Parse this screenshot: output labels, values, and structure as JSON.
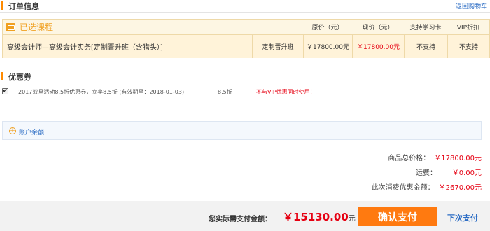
{
  "order_info": {
    "title": "订单信息",
    "back_to_cart": "返回购物车"
  },
  "course_table": {
    "selected_label": "已选课程",
    "headers": {
      "original_price": "原价（元）",
      "current_price": "现价（元）",
      "study_card": "支持学习卡",
      "vip_discount": "VIP折扣"
    },
    "row": {
      "name": "高级会计师—高级会计实务[定制晋升班（含猎头）]",
      "type": "定制晋升班",
      "original_price": "￥17800.00元",
      "current_price": "￥17800.00元",
      "study_card": "不支持",
      "vip_discount": "不支持"
    }
  },
  "coupons": {
    "title": "优惠券",
    "items": [
      {
        "description": "2017双旦活动8.5折优惠券，立享8.5折 (有效期至：2018-01-03)",
        "discount": "8.5折",
        "warning": "不与VIP优惠同时使用！",
        "checked": true
      }
    ]
  },
  "balance": {
    "label": "账户余额"
  },
  "summary": {
    "total_label": "商品总价格：",
    "total_value": "￥17800.00元",
    "shipping_label": "运费：",
    "shipping_value": "￥0.00元",
    "discount_label": "此次消费优惠金额：",
    "discount_value": "￥2670.00元"
  },
  "footer": {
    "pay_label": "您实际需支付金额：",
    "pay_amount": "￥15130.00",
    "pay_unit": "元",
    "confirm_button": "确认支付",
    "pay_later": "下次支付"
  },
  "colors": {
    "accent": "#ff7a10",
    "price_red": "#e60012",
    "link_blue": "#2b6cc4",
    "table_bg": "#fdf6e3"
  }
}
